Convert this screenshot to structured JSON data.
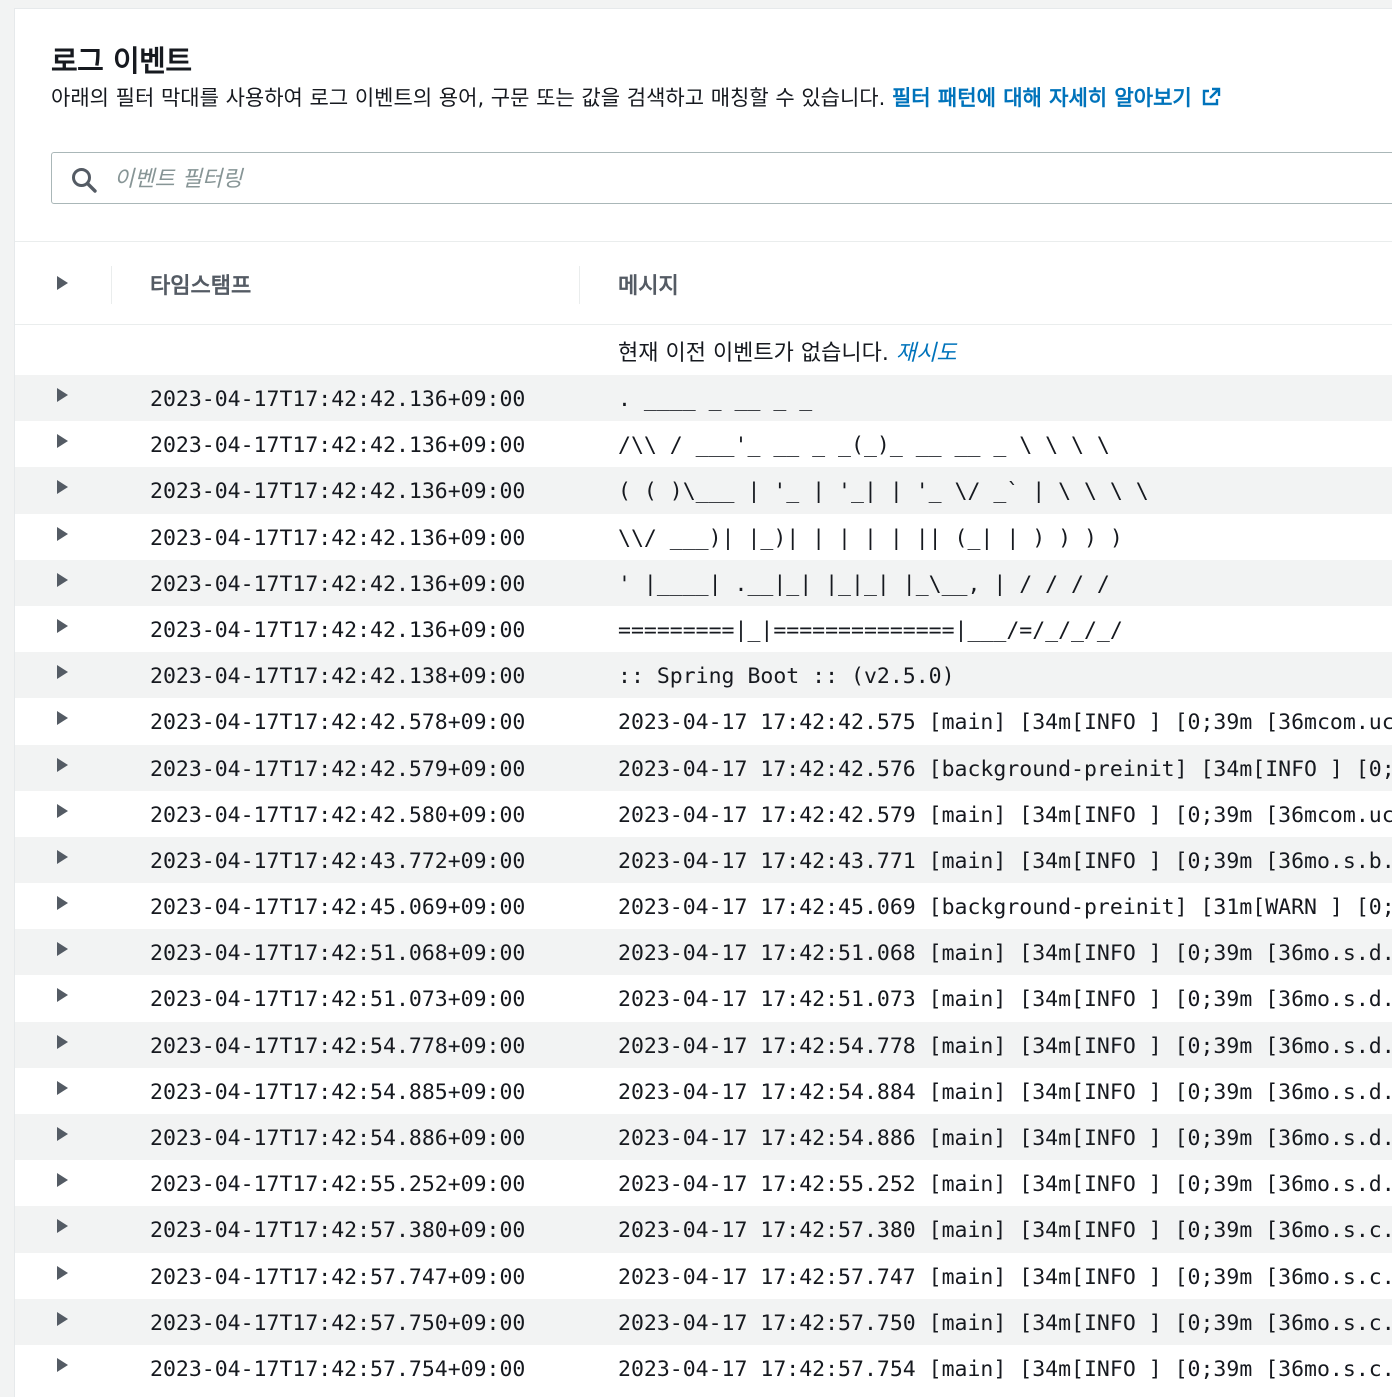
{
  "header": {
    "title": "로그 이벤트",
    "description": "아래의 필터 막대를 사용하여 로그 이벤트의 용어, 구문 또는 값을 검색하고 매칭할 수 있습니다.",
    "learn_more_link": "필터 패턴에 대해 자세히 알아보기"
  },
  "search": {
    "placeholder": "이벤트 필터링",
    "value": ""
  },
  "table": {
    "columns": [
      "타임스탬프",
      "메시지"
    ],
    "notice_text": "현재 이전 이벤트가 없습니다.",
    "retry_link": "재시도",
    "rows": [
      {
        "timestamp": "2023-04-17T17:42:42.136+09:00",
        "message": ". ____ _ __ _ _"
      },
      {
        "timestamp": "2023-04-17T17:42:42.136+09:00",
        "message": "/\\\\ / ___'_ __ _ _(_)_ __ __ _ \\ \\ \\ \\"
      },
      {
        "timestamp": "2023-04-17T17:42:42.136+09:00",
        "message": "( ( )\\___ | '_ | '_| | '_ \\/ _` | \\ \\ \\ \\"
      },
      {
        "timestamp": "2023-04-17T17:42:42.136+09:00",
        "message": "\\\\/ ___)| |_)| | | | | || (_| | ) ) ) )"
      },
      {
        "timestamp": "2023-04-17T17:42:42.136+09:00",
        "message": "' |____| .__|_| |_|_| |_\\__, | / / / /"
      },
      {
        "timestamp": "2023-04-17T17:42:42.136+09:00",
        "message": "=========|_|==============|___/=/_/_/_/"
      },
      {
        "timestamp": "2023-04-17T17:42:42.138+09:00",
        "message": ":: Spring Boot :: (v2.5.0)"
      },
      {
        "timestamp": "2023-04-17T17:42:42.578+09:00",
        "message": "2023-04-17 17:42:42.575 [main]  [34m[INFO ] [0;39m  [36mcom.uc"
      },
      {
        "timestamp": "2023-04-17T17:42:42.579+09:00",
        "message": "2023-04-17 17:42:42.576 [background-preinit]  [34m[INFO ] [0;"
      },
      {
        "timestamp": "2023-04-17T17:42:42.580+09:00",
        "message": "2023-04-17 17:42:42.579 [main]  [34m[INFO ] [0;39m  [36mcom.uc"
      },
      {
        "timestamp": "2023-04-17T17:42:43.772+09:00",
        "message": "2023-04-17 17:42:43.771 [main]  [34m[INFO ] [0;39m  [36mo.s.b."
      },
      {
        "timestamp": "2023-04-17T17:42:45.069+09:00",
        "message": "2023-04-17 17:42:45.069 [background-preinit]  [31m[WARN ] [0;"
      },
      {
        "timestamp": "2023-04-17T17:42:51.068+09:00",
        "message": "2023-04-17 17:42:51.068 [main]  [34m[INFO ] [0;39m  [36mo.s.d."
      },
      {
        "timestamp": "2023-04-17T17:42:51.073+09:00",
        "message": "2023-04-17 17:42:51.073 [main]  [34m[INFO ] [0;39m  [36mo.s.d."
      },
      {
        "timestamp": "2023-04-17T17:42:54.778+09:00",
        "message": "2023-04-17 17:42:54.778 [main]  [34m[INFO ] [0;39m  [36mo.s.d."
      },
      {
        "timestamp": "2023-04-17T17:42:54.885+09:00",
        "message": "2023-04-17 17:42:54.884 [main]  [34m[INFO ] [0;39m  [36mo.s.d."
      },
      {
        "timestamp": "2023-04-17T17:42:54.886+09:00",
        "message": "2023-04-17 17:42:54.886 [main]  [34m[INFO ] [0;39m  [36mo.s.d."
      },
      {
        "timestamp": "2023-04-17T17:42:55.252+09:00",
        "message": "2023-04-17 17:42:55.252 [main]  [34m[INFO ] [0;39m  [36mo.s.d."
      },
      {
        "timestamp": "2023-04-17T17:42:57.380+09:00",
        "message": "2023-04-17 17:42:57.380 [main]  [34m[INFO ] [0;39m  [36mo.s.c."
      },
      {
        "timestamp": "2023-04-17T17:42:57.747+09:00",
        "message": "2023-04-17 17:42:57.747 [main]  [34m[INFO ] [0;39m  [36mo.s.c."
      },
      {
        "timestamp": "2023-04-17T17:42:57.750+09:00",
        "message": "2023-04-17 17:42:57.750 [main]  [34m[INFO ] [0;39m  [36mo.s.c."
      },
      {
        "timestamp": "2023-04-17T17:42:57.754+09:00",
        "message": "2023-04-17 17:42:57.754 [main]  [34m[INFO ] [0;39m  [36mo.s.c."
      }
    ]
  },
  "colors": {
    "link": "#0073bb",
    "text": "#16191f",
    "muted": "#545b64",
    "stripe": "#f2f3f3"
  },
  "icons": {
    "search": "search-icon",
    "external_link": "external-link-icon",
    "expand": "caret-right-icon"
  }
}
